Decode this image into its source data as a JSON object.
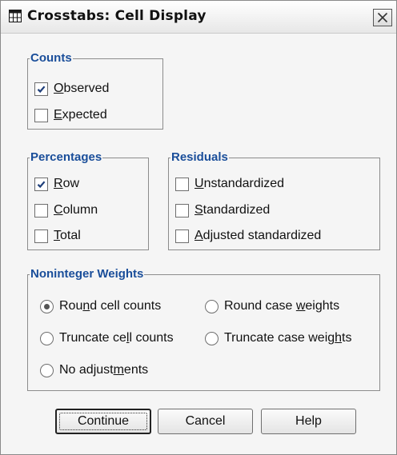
{
  "window": {
    "title": "Crosstabs: Cell Display"
  },
  "counts": {
    "legend": "Counts",
    "items": [
      {
        "pre": "",
        "key": "O",
        "post": "bserved",
        "checked": true
      },
      {
        "pre": "",
        "key": "E",
        "post": "xpected",
        "checked": false
      }
    ]
  },
  "percentages": {
    "legend": "Percentages",
    "items": [
      {
        "pre": "",
        "key": "R",
        "post": "ow",
        "checked": true
      },
      {
        "pre": "",
        "key": "C",
        "post": "olumn",
        "checked": false
      },
      {
        "pre": "",
        "key": "T",
        "post": "otal",
        "checked": false
      }
    ]
  },
  "residuals": {
    "legend": "Residuals",
    "items": [
      {
        "pre": "",
        "key": "U",
        "post": "nstandardized",
        "checked": false
      },
      {
        "pre": "",
        "key": "S",
        "post": "tandardized",
        "checked": false
      },
      {
        "pre": "",
        "key": "A",
        "post": "djusted standardized",
        "checked": false
      }
    ]
  },
  "weights": {
    "legend": "Noninteger Weights",
    "options": [
      {
        "pre": "Rou",
        "key": "n",
        "post": "d cell counts",
        "selected": true
      },
      {
        "pre": "Round case ",
        "key": "w",
        "post": "eights",
        "selected": false
      },
      {
        "pre": "Truncate ce",
        "key": "l",
        "post": "l counts",
        "selected": false
      },
      {
        "pre": "Truncate case weig",
        "key": "h",
        "post": "ts",
        "selected": false
      },
      {
        "pre": "No adjust",
        "key": "m",
        "post": "ents",
        "selected": false
      }
    ]
  },
  "buttons": {
    "continue": "Continue",
    "cancel": "Cancel",
    "help": "Help"
  },
  "colors": {
    "legend_text": "#1a4e9a",
    "dialog_bg": "#f5f5f5",
    "check_mark": "#1f3f7a"
  },
  "icons": {
    "app": "table-grid-icon",
    "close": "close-x-icon",
    "check": "check-mark-icon"
  }
}
